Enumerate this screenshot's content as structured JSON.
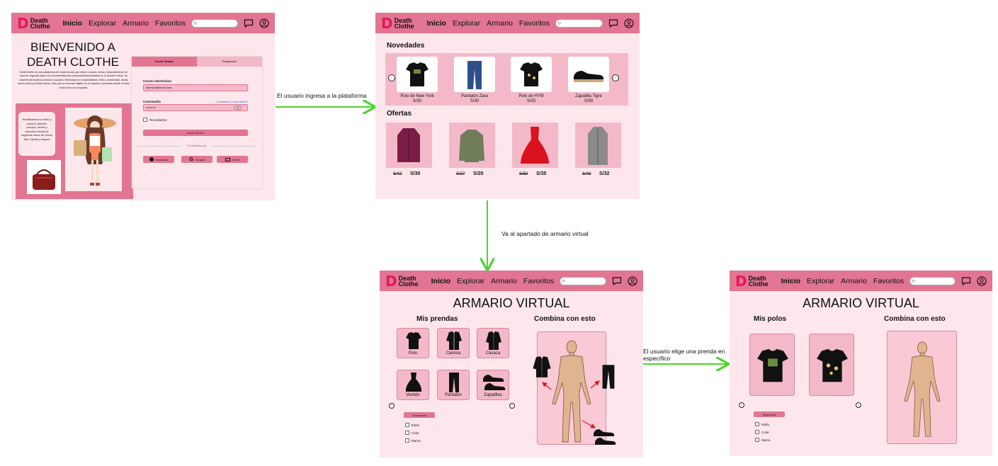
{
  "nav": {
    "logo_mark": "D",
    "logo_text": "Death Clothe",
    "links": [
      "Inicio",
      "Explorar",
      "Armario",
      "Favoritos"
    ],
    "search_value": "Q"
  },
  "login": {
    "welcome_line1": "BIENVENIDO A",
    "welcome_line2": "DEATH CLOTHE",
    "description": "DeathClothe es una plataforma de moda circular que ofrece compra, venta y descubrimiento de ropa de segunda mano con recomendaciones personalizadas basadas en tu armario virtual. Su experiencia intuitiva conecta a usuarios interesados en sostenibilidad, estilo y creatividad, dando nueva vida a prendas únicas. Más que un mercado digital, es un espacio conectado donde el estilo evoluciona con propósito.",
    "promo": "Reutilizamos tu estilo y cuida el planeta: compra, vende y descubre moda de segunda mano de forma fácil, rápida y segura",
    "tab_login": "Iniciar Sesión",
    "tab_register": "Registrarse",
    "email_label": "Correo electrónico",
    "email_value": "ejemplo@email.com",
    "password_label": "Contraseña",
    "forgot": "¿Olvidaste tu contraseña?",
    "password_value": "••••••••••",
    "remember": "Recordarme",
    "submit": "Iniciar Sesión",
    "or_continue": "O continúa con",
    "social": [
      "Facebook",
      "Google",
      "Email"
    ]
  },
  "home": {
    "news_title": "Novedades",
    "news": [
      {
        "name": "Polo de New York",
        "price": "S/30"
      },
      {
        "name": "Pantalón Zara",
        "price": "S/30"
      },
      {
        "name": "Polo de HYM",
        "price": "S/25"
      },
      {
        "name": "Zapatilla Tigre",
        "price": "S/30"
      }
    ],
    "offers_title": "Ofertas",
    "offers": [
      {
        "old": "S/42",
        "new": "S/30"
      },
      {
        "old": "S/37",
        "new": "S/20"
      },
      {
        "old": "S/50",
        "new": "S/35"
      },
      {
        "old": "S/48",
        "new": "S/32"
      }
    ]
  },
  "wardrobe": {
    "title": "ARMARIO VIRTUAL",
    "my_items": "Mis prendas",
    "combine": "Combina con esto",
    "categories": [
      "Polo",
      "Camisa",
      "Casaca",
      "Vestido",
      "Pantalon",
      "Zapatillas"
    ],
    "season_btn": "Temporada",
    "filters": [
      "Estilo",
      "Color",
      "Marca"
    ]
  },
  "polos": {
    "title": "ARMARIO VIRTUAL",
    "my_items": "Mis polos",
    "combine": "Combina con esto",
    "season_btn": "Temporada",
    "filters": [
      "Estilo",
      "Color",
      "Marca"
    ]
  },
  "arrows": {
    "a1": "El usuario ingresa a la plataforma",
    "a2": "Va al apartado de armario virtual",
    "a3_line1": "El usuario elige una prenda en",
    "a3_line2": "específico"
  },
  "colors": {
    "accent": "#e27592",
    "screen_bg": "#fde7ec",
    "arrow": "#4cd52c",
    "logo": "#e8175a"
  }
}
